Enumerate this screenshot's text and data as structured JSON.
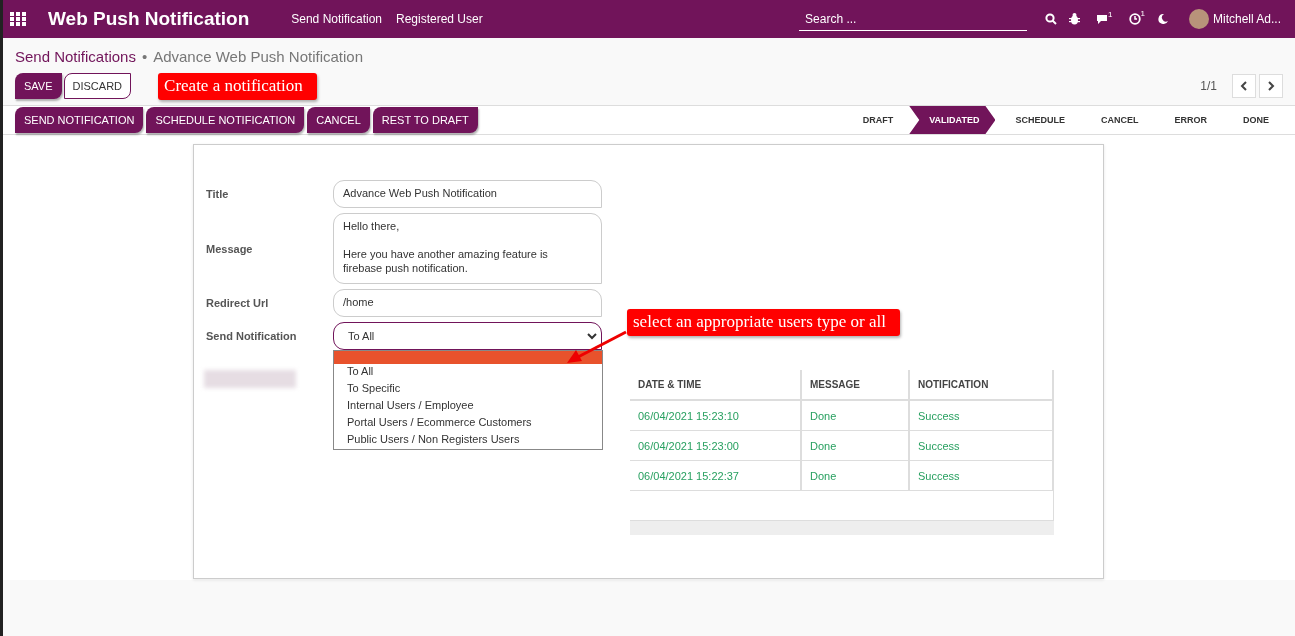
{
  "navbar": {
    "app_name": "Web Push Notification",
    "menu": [
      "Send Notification",
      "Registered User"
    ],
    "search": {
      "placeholder": "Search ..."
    },
    "chat_badge": "1",
    "activity_badge": "1",
    "user": "Mitchell Ad..."
  },
  "breadcrumb": {
    "parent": "Send Notifications",
    "separator": "•",
    "current": "Advance Web Push Notification"
  },
  "control_buttons": [
    "SAVE",
    "DISCARD"
  ],
  "pager": {
    "text": "1/1"
  },
  "header_buttons": [
    "SEND NOTIFICATION",
    "SCHEDULE NOTIFICATION",
    "CANCEL",
    "REST TO DRAFT"
  ],
  "stages": [
    {
      "label": "DRAFT",
      "selected": false
    },
    {
      "label": "VALIDATED",
      "selected": true
    },
    {
      "label": "SCHEDULE",
      "selected": false
    },
    {
      "label": "CANCEL",
      "selected": false
    },
    {
      "label": "ERROR",
      "selected": false
    },
    {
      "label": "DONE",
      "selected": false
    }
  ],
  "form": {
    "title_label": "Title",
    "title": "Advance Web Push Notification",
    "message_label": "Message",
    "message_paragraphs": [
      [
        "Hello there,"
      ],
      [
        "Here you have another amazing feature is",
        "firebase push notification."
      ]
    ],
    "url_label": "Redirect Url",
    "url": "/home",
    "send_label": "Send Notification",
    "send_value": "To All",
    "options": [
      "To All",
      "To Specific",
      "Internal Users / Employee",
      "Portal Users / Ecommerce Customers",
      "Public Users / Non Registers Users"
    ]
  },
  "table": {
    "columns": [
      "DATE & TIME",
      "MESSAGE",
      "NOTIFICATION"
    ],
    "rows": [
      [
        "06/04/2021 15:23:10",
        "Done",
        "Success"
      ],
      [
        "06/04/2021 15:23:00",
        "Done",
        "Success"
      ],
      [
        "06/04/2021 15:22:37",
        "Done",
        "Success"
      ]
    ]
  },
  "annotations": [
    "Create a notification",
    "select an appropriate users type or all"
  ]
}
